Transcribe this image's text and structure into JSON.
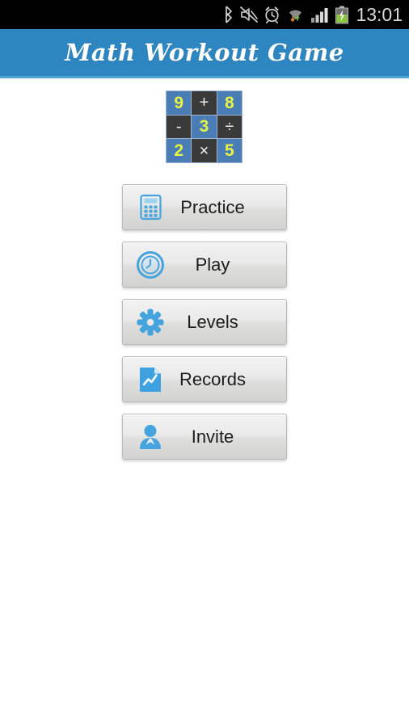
{
  "status_bar": {
    "icons": [
      {
        "name": "bluetooth-icon",
        "label": "bluetooth"
      },
      {
        "name": "mute-icon",
        "label": "sound-muted"
      },
      {
        "name": "alarm-icon",
        "label": "alarm-set"
      },
      {
        "name": "wifi-icon",
        "label": "wifi-signal"
      },
      {
        "name": "cellular-signal-icon",
        "label": "cellular-signal"
      },
      {
        "name": "battery-charging-icon",
        "label": "battery-charging"
      }
    ],
    "time": "13:01",
    "background_color": "#000000",
    "text_color": "#d8d8d8",
    "battery_color": "#8cc63f"
  },
  "header": {
    "title": "Math Workout Game",
    "background_color": "#2e86c1",
    "accent_color": "#4fa3d6",
    "text_color": "#ffffff"
  },
  "logo": {
    "name": "math-grid-logo",
    "rows": [
      [
        {
          "text": "9",
          "type": "num"
        },
        {
          "text": "+",
          "type": "op"
        },
        {
          "text": "8",
          "type": "num"
        }
      ],
      [
        {
          "text": "-",
          "type": "op"
        },
        {
          "text": "3",
          "type": "num"
        },
        {
          "text": "÷",
          "type": "op"
        }
      ],
      [
        {
          "text": "2",
          "type": "num"
        },
        {
          "text": "×",
          "type": "op"
        },
        {
          "text": "5",
          "type": "num"
        }
      ]
    ],
    "number_cell_color": "#4a7cb5",
    "operator_cell_color": "#3a3a3a",
    "number_text_color": "#e8f442",
    "operator_text_color": "#efefef"
  },
  "menu": {
    "accent_color": "#45a3dd",
    "buttons": [
      {
        "label": "Practice",
        "icon": "calculator-icon"
      },
      {
        "label": "Play",
        "icon": "stopwatch-icon"
      },
      {
        "label": "Levels",
        "icon": "gear-icon"
      },
      {
        "label": "Records",
        "icon": "chart-document-icon"
      },
      {
        "label": "Invite",
        "icon": "person-icon"
      }
    ]
  }
}
